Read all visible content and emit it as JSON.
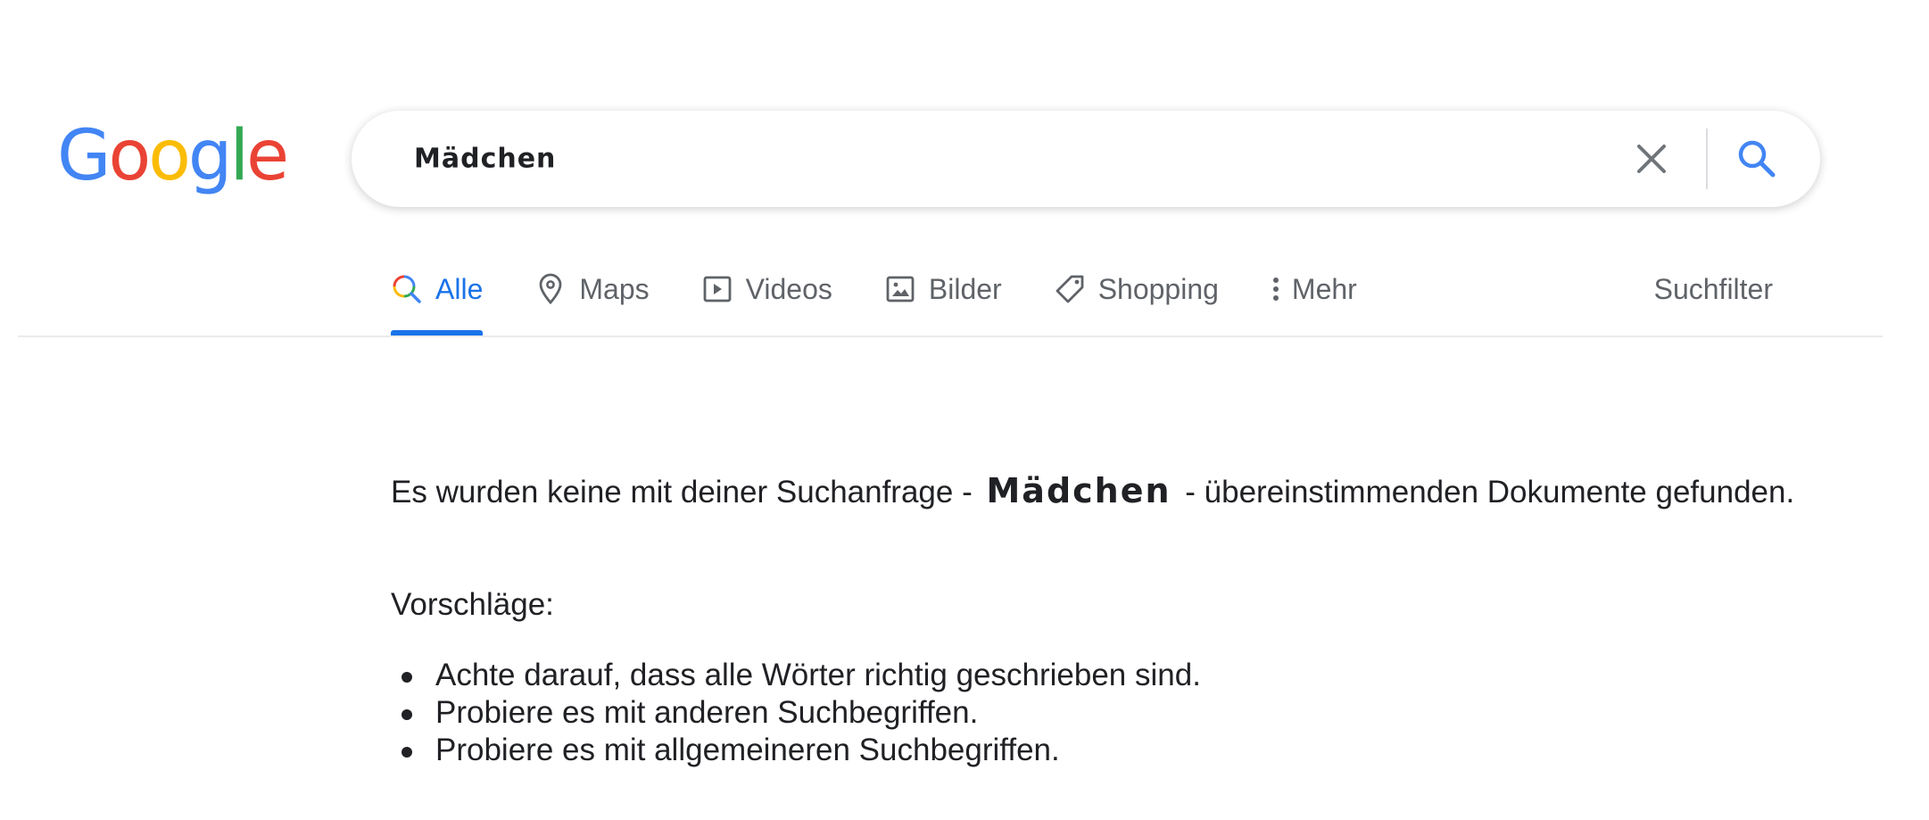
{
  "logo": {
    "letters": [
      "G",
      "o",
      "o",
      "g",
      "l",
      "e"
    ],
    "colors": [
      "#4285F4",
      "#EA4335",
      "#FBBC05",
      "#4285F4",
      "#34A853",
      "#EA4335"
    ]
  },
  "search": {
    "query": "Mädchen",
    "clear_icon": "close-icon",
    "search_icon": "search-icon"
  },
  "tabs": [
    {
      "label": "Alle",
      "icon": "search-icon",
      "active": true
    },
    {
      "label": "Maps",
      "icon": "map-pin-icon",
      "active": false
    },
    {
      "label": "Videos",
      "icon": "play-icon",
      "active": false
    },
    {
      "label": "Bilder",
      "icon": "image-icon",
      "active": false
    },
    {
      "label": "Shopping",
      "icon": "tag-icon",
      "active": false
    },
    {
      "label": "Mehr",
      "icon": "more-vert-icon",
      "active": false
    }
  ],
  "suchfilter_label": "Suchfilter",
  "results": {
    "no_results_prefix": "Es wurden keine mit deiner Suchanfrage -",
    "query": "Mädchen",
    "no_results_suffix": "- übereinstimmenden Dokumente gefunden.",
    "suggestions_title": "Vorschläge:",
    "suggestions": [
      "Achte darauf, dass alle Wörter richtig geschrieben sind.",
      "Probiere es mit anderen Suchbegriffen.",
      "Probiere es mit allgemeineren Suchbegriffen."
    ]
  },
  "colors": {
    "accent": "#1a73e8",
    "text": "#202124",
    "muted": "#5f6368"
  }
}
